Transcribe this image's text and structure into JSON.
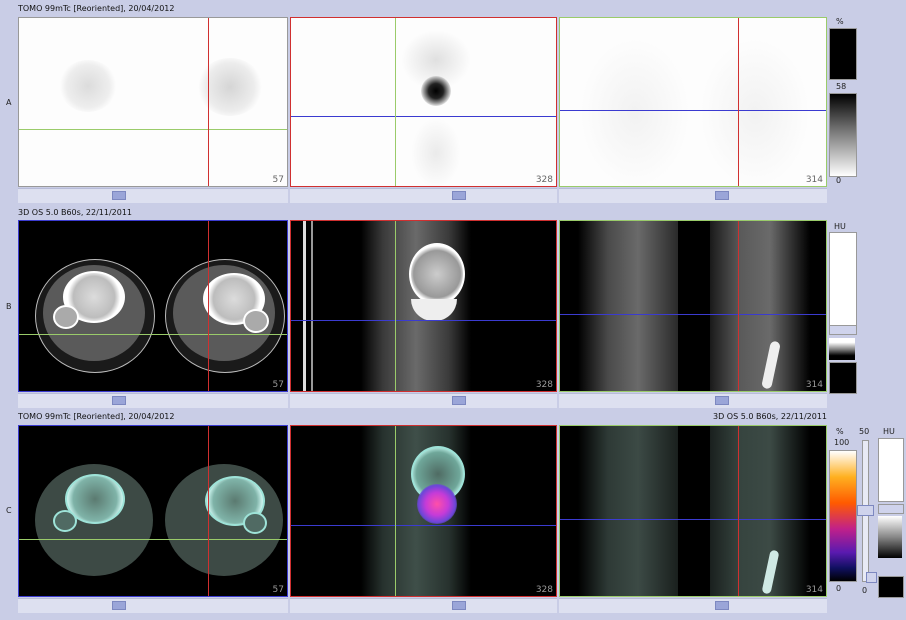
{
  "rows": {
    "a": {
      "letter": "A",
      "title": "TOMO 99mTc [Reoriented], 20/04/2012",
      "slices": [
        "57",
        "328",
        "314"
      ],
      "scale": {
        "unit": "%",
        "value_top": "58",
        "value_bottom": "0"
      }
    },
    "b": {
      "letter": "B",
      "title": "3D  OS  5.0  B60s, 22/11/2011",
      "slices": [
        "57",
        "328",
        "314"
      ],
      "scale": {
        "unit": "HU"
      }
    },
    "c": {
      "letter": "C",
      "title_left": "TOMO 99mTc [Reoriented], 20/04/2012",
      "title_right": "3D  OS  5.0  B60s, 22/11/2011",
      "slices": [
        "57",
        "328",
        "314"
      ],
      "scale": {
        "unit_pct": "%",
        "unit_hu": "HU",
        "pct_top": "100",
        "pct_bottom": "0",
        "window": "50",
        "hu_bottom": "0"
      }
    }
  },
  "colors": {
    "crosshair_red": "#d03030",
    "crosshair_green": "#9acb6a",
    "crosshair_blue": "#3b3bd0",
    "background": "#c9cde6"
  }
}
